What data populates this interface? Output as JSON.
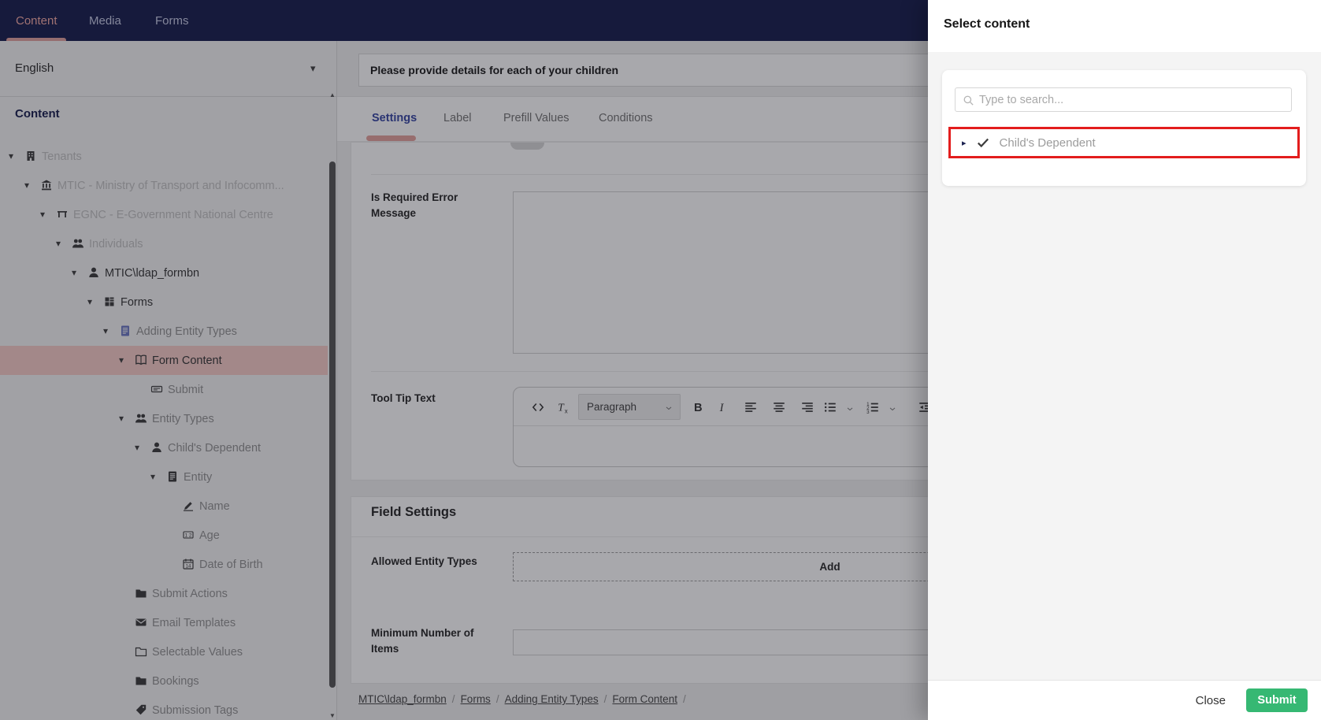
{
  "nav": {
    "tabs": [
      {
        "label": "Content",
        "active": true
      },
      {
        "label": "Media",
        "active": false
      },
      {
        "label": "Forms",
        "active": false
      }
    ]
  },
  "sidebar": {
    "language": "English",
    "section_title": "Content",
    "tree": [
      {
        "label": "Tenants",
        "icon": "building-icon",
        "level": 0,
        "arrow": true,
        "tone": "light"
      },
      {
        "label": "MTIC - Ministry of Transport and Infocomm...",
        "icon": "bank-icon",
        "level": 1,
        "arrow": true,
        "tone": "light"
      },
      {
        "label": "EGNC - E-Government National Centre",
        "icon": "bridge-icon",
        "level": 2,
        "arrow": true,
        "tone": "light"
      },
      {
        "label": "Individuals",
        "icon": "users-icon",
        "level": 3,
        "arrow": true,
        "tone": "light"
      },
      {
        "label": "MTIC\\ldap_formbn",
        "icon": "user-icon",
        "level": 4,
        "arrow": true,
        "tone": "strong"
      },
      {
        "label": "Forms",
        "icon": "grid-icon",
        "level": 5,
        "arrow": true,
        "tone": "strong"
      },
      {
        "label": "Adding Entity Types",
        "icon": "document-icon",
        "level": 6,
        "arrow": true,
        "tone": "normal",
        "icon_color": "#6e7bc4"
      },
      {
        "label": "Form Content",
        "icon": "book-icon",
        "level": 7,
        "arrow": true,
        "tone": "strong",
        "selected": true
      },
      {
        "label": "Submit",
        "icon": "stamp-icon",
        "level": 8,
        "arrow": false,
        "tone": "normal"
      },
      {
        "label": "Entity Types",
        "icon": "users-icon",
        "level": 7,
        "arrow": true,
        "tone": "normal"
      },
      {
        "label": "Child's Dependent",
        "icon": "user-icon",
        "level": 8,
        "arrow": true,
        "tone": "normal"
      },
      {
        "label": "Entity",
        "icon": "document-icon",
        "level": 9,
        "arrow": true,
        "tone": "normal"
      },
      {
        "label": "Name",
        "icon": "signature-icon",
        "level": 10,
        "arrow": false,
        "tone": "normal"
      },
      {
        "label": "Age",
        "icon": "number-icon",
        "level": 10,
        "arrow": false,
        "tone": "normal"
      },
      {
        "label": "Date of Birth",
        "icon": "calendar-icon",
        "level": 10,
        "arrow": false,
        "tone": "normal"
      },
      {
        "label": "Submit Actions",
        "icon": "folder-icon",
        "level": 7,
        "arrow": false,
        "tone": "normal"
      },
      {
        "label": "Email Templates",
        "icon": "mail-icon",
        "level": 7,
        "arrow": false,
        "tone": "normal"
      },
      {
        "label": "Selectable Values",
        "icon": "folder-outline-icon",
        "level": 7,
        "arrow": false,
        "tone": "normal"
      },
      {
        "label": "Bookings",
        "icon": "folder-icon",
        "level": 7,
        "arrow": false,
        "tone": "normal"
      },
      {
        "label": "Submission Tags",
        "icon": "tag-icon",
        "level": 7,
        "arrow": false,
        "tone": "normal"
      }
    ]
  },
  "main": {
    "title_value": "Please provide details for each of your children",
    "tabs": [
      {
        "label": "Settings",
        "active": true
      },
      {
        "label": "Label",
        "active": false
      },
      {
        "label": "Prefill Values",
        "active": false
      },
      {
        "label": "Conditions",
        "active": false
      }
    ],
    "fields": {
      "is_required_error_message_label": "Is Required Error Message",
      "is_required_error_message_value": "",
      "tool_tip_text_label": "Tool Tip Text",
      "editor": {
        "paragraph_label": "Paragraph",
        "toolbar": [
          "source-code",
          "clear-formatting",
          "paragraph-style-select",
          "bold",
          "italic",
          "align-left",
          "align-center",
          "align-right",
          "bullet-list",
          "bullet-list-caret",
          "numbered-list",
          "numbered-list-caret",
          "outdent"
        ]
      }
    },
    "field_settings": {
      "title": "Field Settings",
      "allowed_entity_types_label": "Allowed Entity Types",
      "add_button": "Add",
      "minimum_number_of_items_label": "Minimum Number of Items",
      "minimum_number_of_items_value": ""
    },
    "breadcrumb": [
      "MTIC\\ldap_formbn",
      "Forms",
      "Adding Entity Types",
      "Form Content"
    ]
  },
  "panel": {
    "title": "Select content",
    "search_placeholder": "Type to search...",
    "items": [
      {
        "label": "Child's Dependent",
        "checked": true,
        "highlighted": true
      }
    ],
    "close_button": "Close",
    "submit_button": "Submit"
  },
  "colors": {
    "nav_bg": "#1b2150",
    "accent_salmon": "#e5a39e",
    "selected_row_bg": "#f8cdc8",
    "highlight_red": "#e31d1d",
    "submit_green": "#36b873",
    "active_tab_blue": "#3b4aa5"
  }
}
